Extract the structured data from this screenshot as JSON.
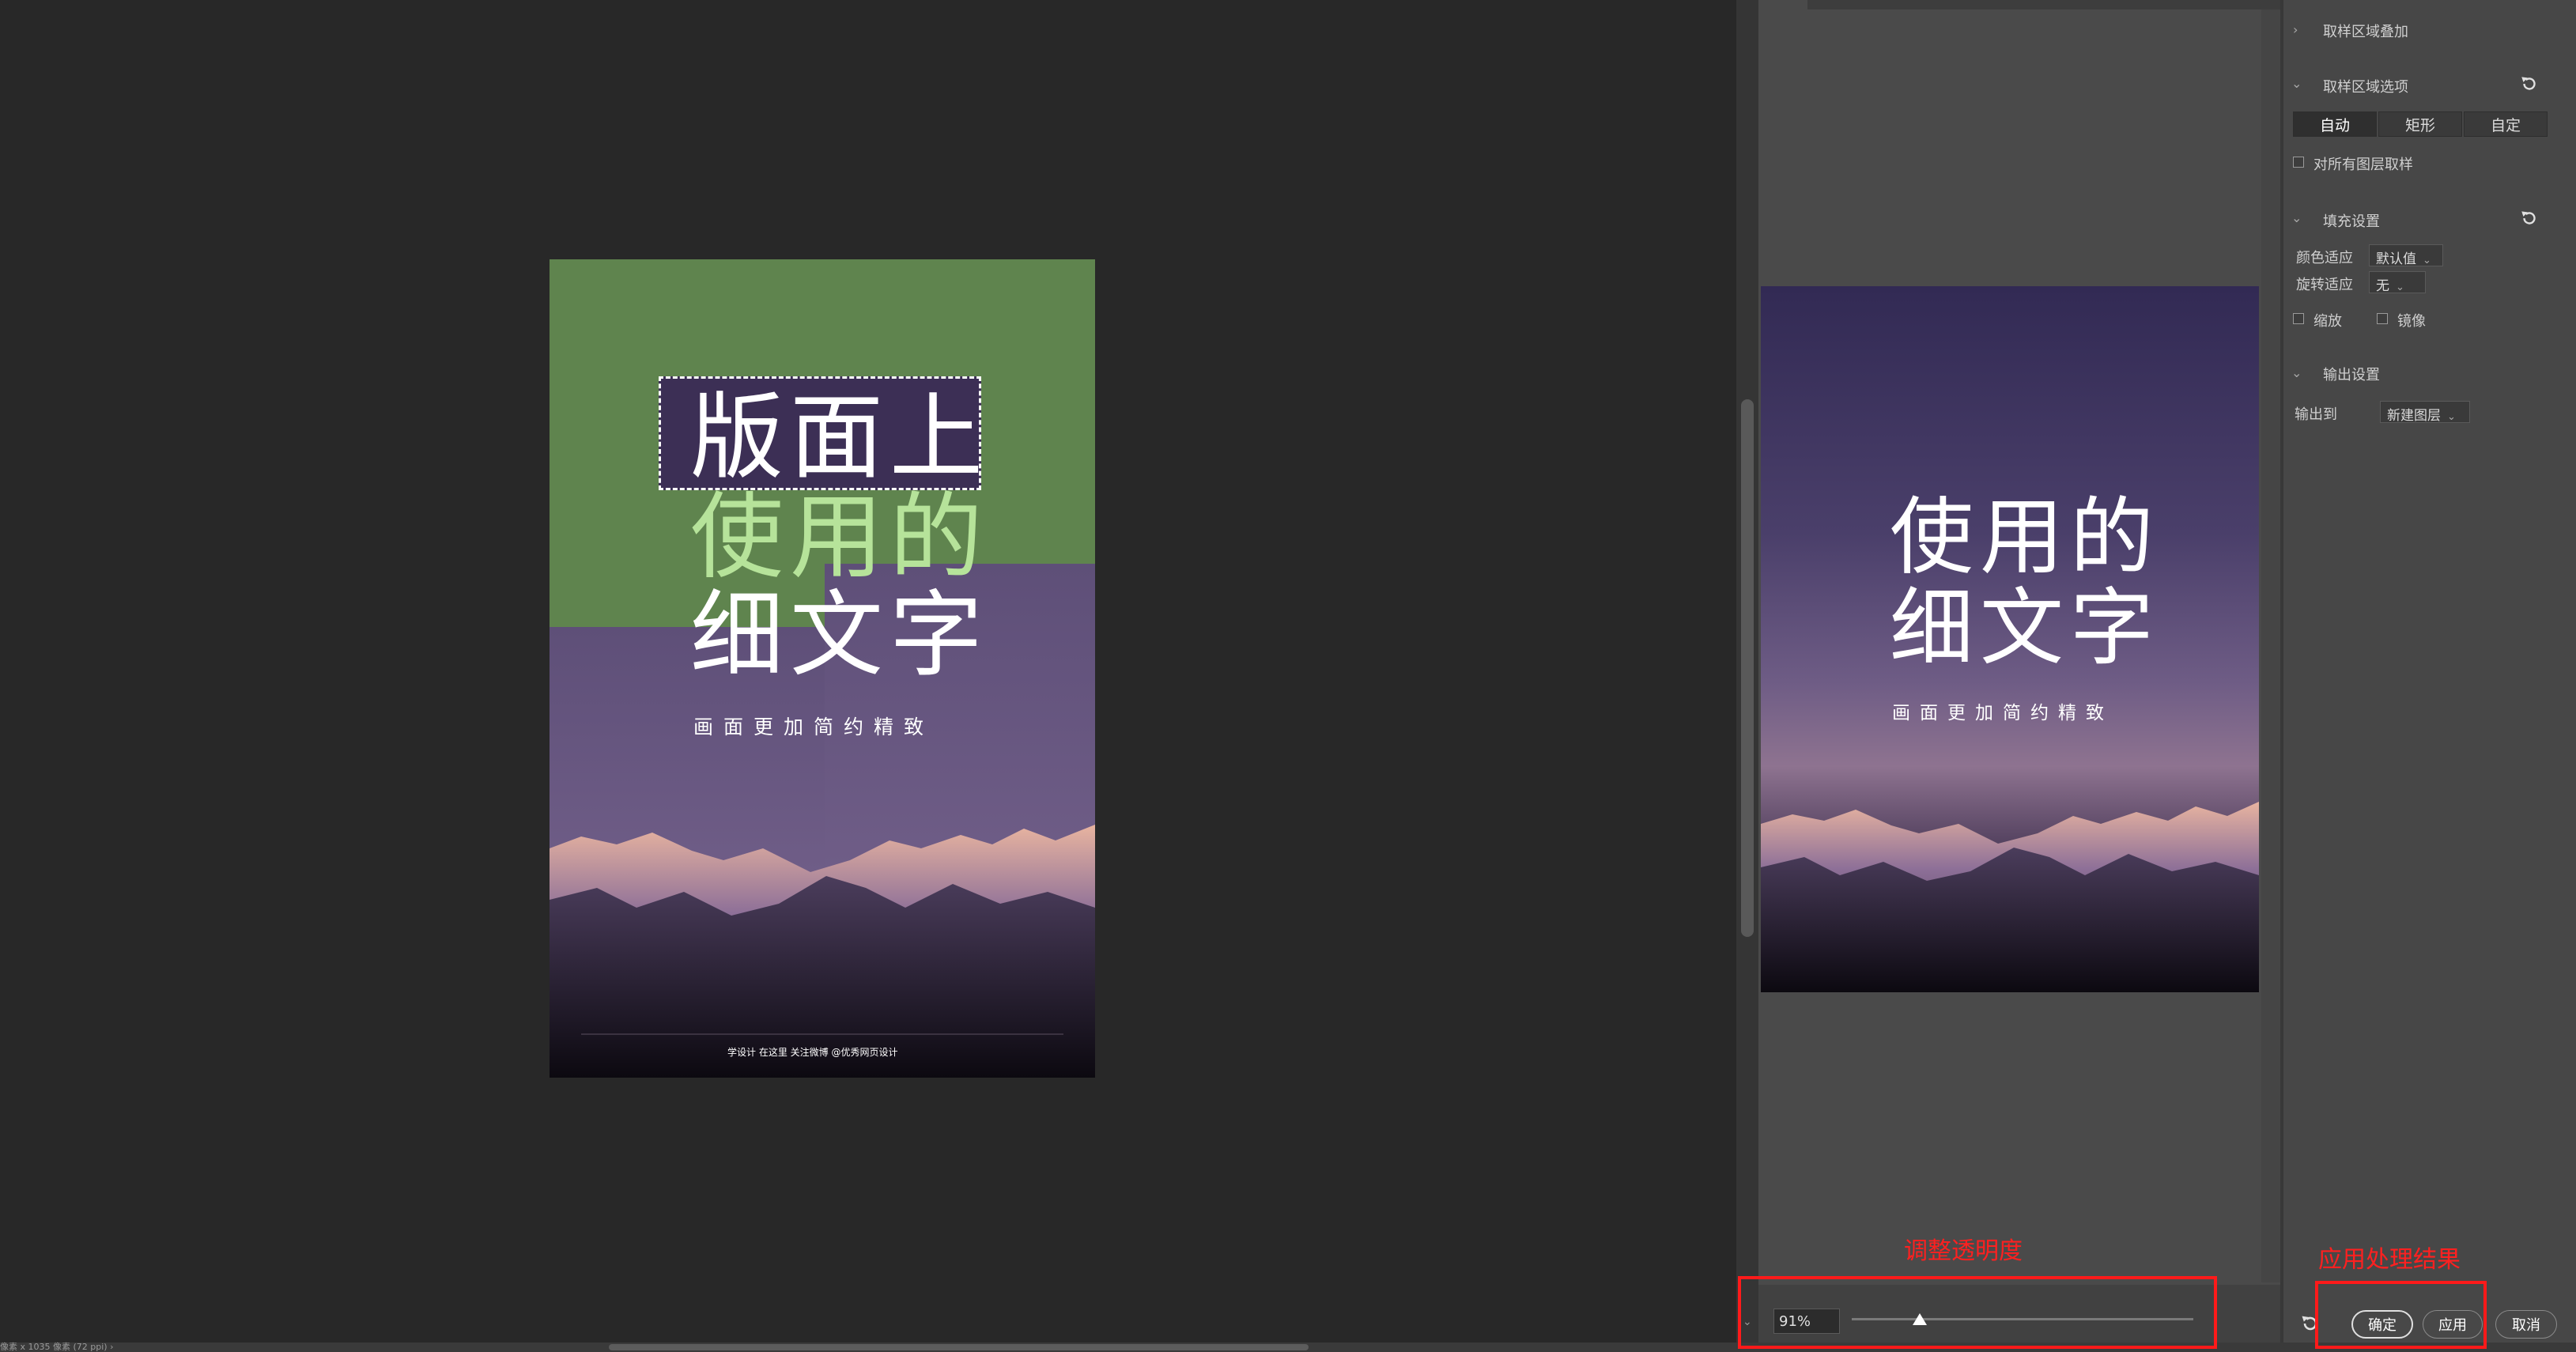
{
  "poster": {
    "headline_line1": "版面上",
    "headline_line2": "使用的",
    "headline_line3": "细文字",
    "subtitle": "画面更加简约精致",
    "footer": "学设计 在这里   关注微博 @优秀网页设计"
  },
  "preview": {
    "headline_line1": "使用的",
    "headline_line2": "细文字",
    "subtitle": "画面更加简约精致"
  },
  "opacity": {
    "value_text": "91%",
    "slider_fraction": 0.2,
    "annotation": "调整透明度"
  },
  "status_bar": {
    "text": "像素 x 1035 像素 (72 ppi)   ›"
  },
  "panel": {
    "section_sampling_overlay": "取样区域叠加",
    "section_sampling_options": "取样区域选项",
    "segments": [
      "自动",
      "矩形",
      "自定"
    ],
    "sample_all_layers": "对所有图层取样",
    "section_fill": "填充设置",
    "color_adapt_label": "颜色适应",
    "color_adapt_value": "默认值",
    "rotation_adapt_label": "旋转适应",
    "rotation_adapt_value": "无",
    "scale_label": "缩放",
    "mirror_label": "镜像",
    "section_output": "输出设置",
    "output_to_label": "输出到",
    "output_to_value": "新建图层"
  },
  "buttons": {
    "ok": "确定",
    "apply": "应用",
    "cancel": "取消",
    "annotation": "应用处理结果"
  },
  "colors": {
    "annotation_red": "#ff1a1a",
    "poster_green": "#5f844e",
    "poster_text_green": "#b6e39a"
  }
}
